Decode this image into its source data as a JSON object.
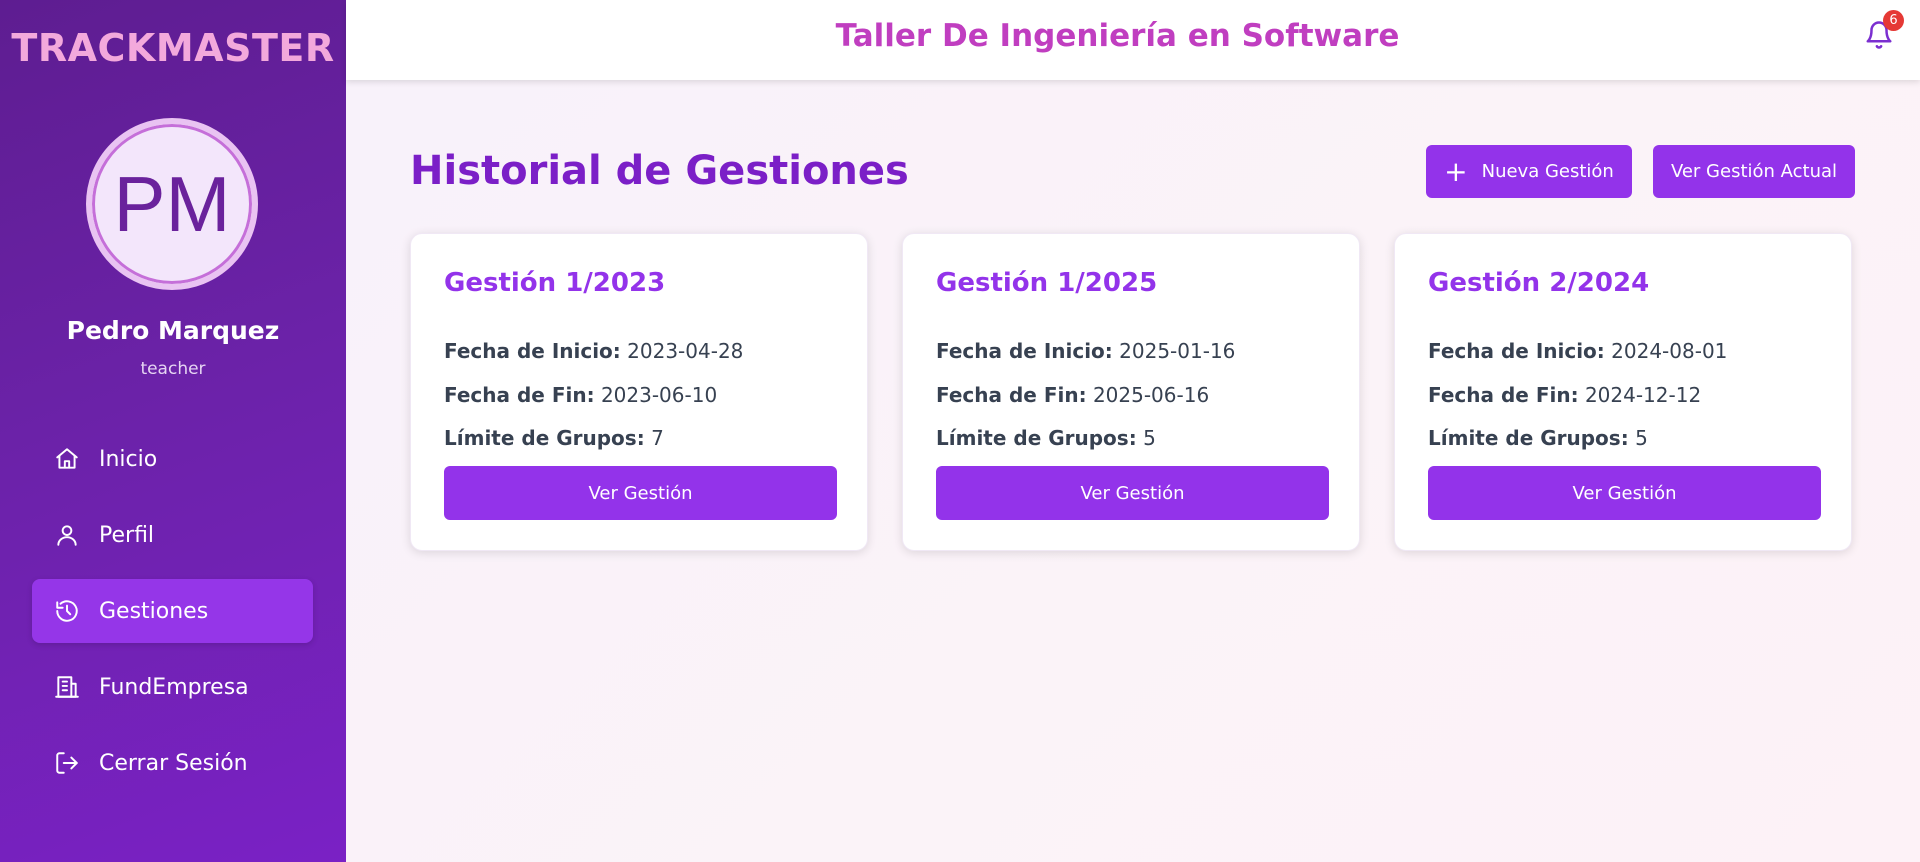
{
  "brand": "TRACKMASTER",
  "user": {
    "initials": "PM",
    "name": "Pedro Marquez",
    "role": "teacher"
  },
  "nav": [
    {
      "label": "Inicio",
      "icon": "home-icon"
    },
    {
      "label": "Perfil",
      "icon": "user-icon"
    },
    {
      "label": "Gestiones",
      "icon": "history-icon",
      "active": true
    },
    {
      "label": "FundEmpresa",
      "icon": "building-icon"
    },
    {
      "label": "Cerrar Sesión",
      "icon": "logout-icon"
    }
  ],
  "header": {
    "title": "Taller De Ingeniería en Software",
    "notification_count": "6"
  },
  "main": {
    "title": "Historial de Gestiones",
    "new_button": "Nueva Gestión",
    "current_button": "Ver Gestión Actual"
  },
  "labels": {
    "start": "Fecha de Inicio:",
    "end": "Fecha de Fin:",
    "limit": "Límite de Grupos:",
    "view": "Ver Gestión"
  },
  "cards": [
    {
      "title": "Gestión 1/2023",
      "start": "2023-04-28",
      "end": "2023-06-10",
      "limit": "7"
    },
    {
      "title": "Gestión 1/2025",
      "start": "2025-01-16",
      "end": "2025-06-16",
      "limit": "5"
    },
    {
      "title": "Gestión 2/2024",
      "start": "2024-08-01",
      "end": "2024-12-12",
      "limit": "5"
    }
  ],
  "colors": {
    "primary": "#9333ea",
    "sidebar": "#6b22a8",
    "title": "#7b1fc7",
    "header_title": "#c03ec0",
    "brand": "#f3a9dc"
  }
}
